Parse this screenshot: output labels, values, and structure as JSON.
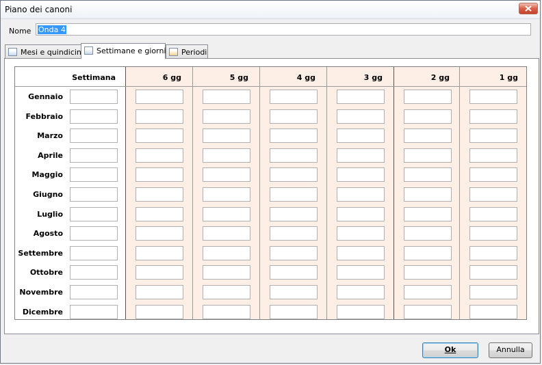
{
  "window": {
    "title": "Piano dei canoni"
  },
  "nome": {
    "label": "Nome",
    "value": "Onda 4"
  },
  "tabs": [
    {
      "label": "Mesi e quindicine",
      "active": false
    },
    {
      "label": "Settimane e giorni",
      "active": true
    },
    {
      "label": "Periodi",
      "active": false
    }
  ],
  "table": {
    "headers": [
      "Settimana",
      "6 gg",
      "5 gg",
      "4 gg",
      "3 gg",
      "2 gg",
      "1 gg"
    ],
    "months": [
      "Gennaio",
      "Febbraio",
      "Marzo",
      "Aprile",
      "Maggio",
      "Giugno",
      "Luglio",
      "Agosto",
      "Settembre",
      "Ottobre",
      "Novembre",
      "Dicembre"
    ]
  },
  "buttons": {
    "ok": "Ok",
    "cancel": "Annulla"
  },
  "colors": {
    "pink_columns": "#fdeee6",
    "selection": "#3399ff"
  }
}
